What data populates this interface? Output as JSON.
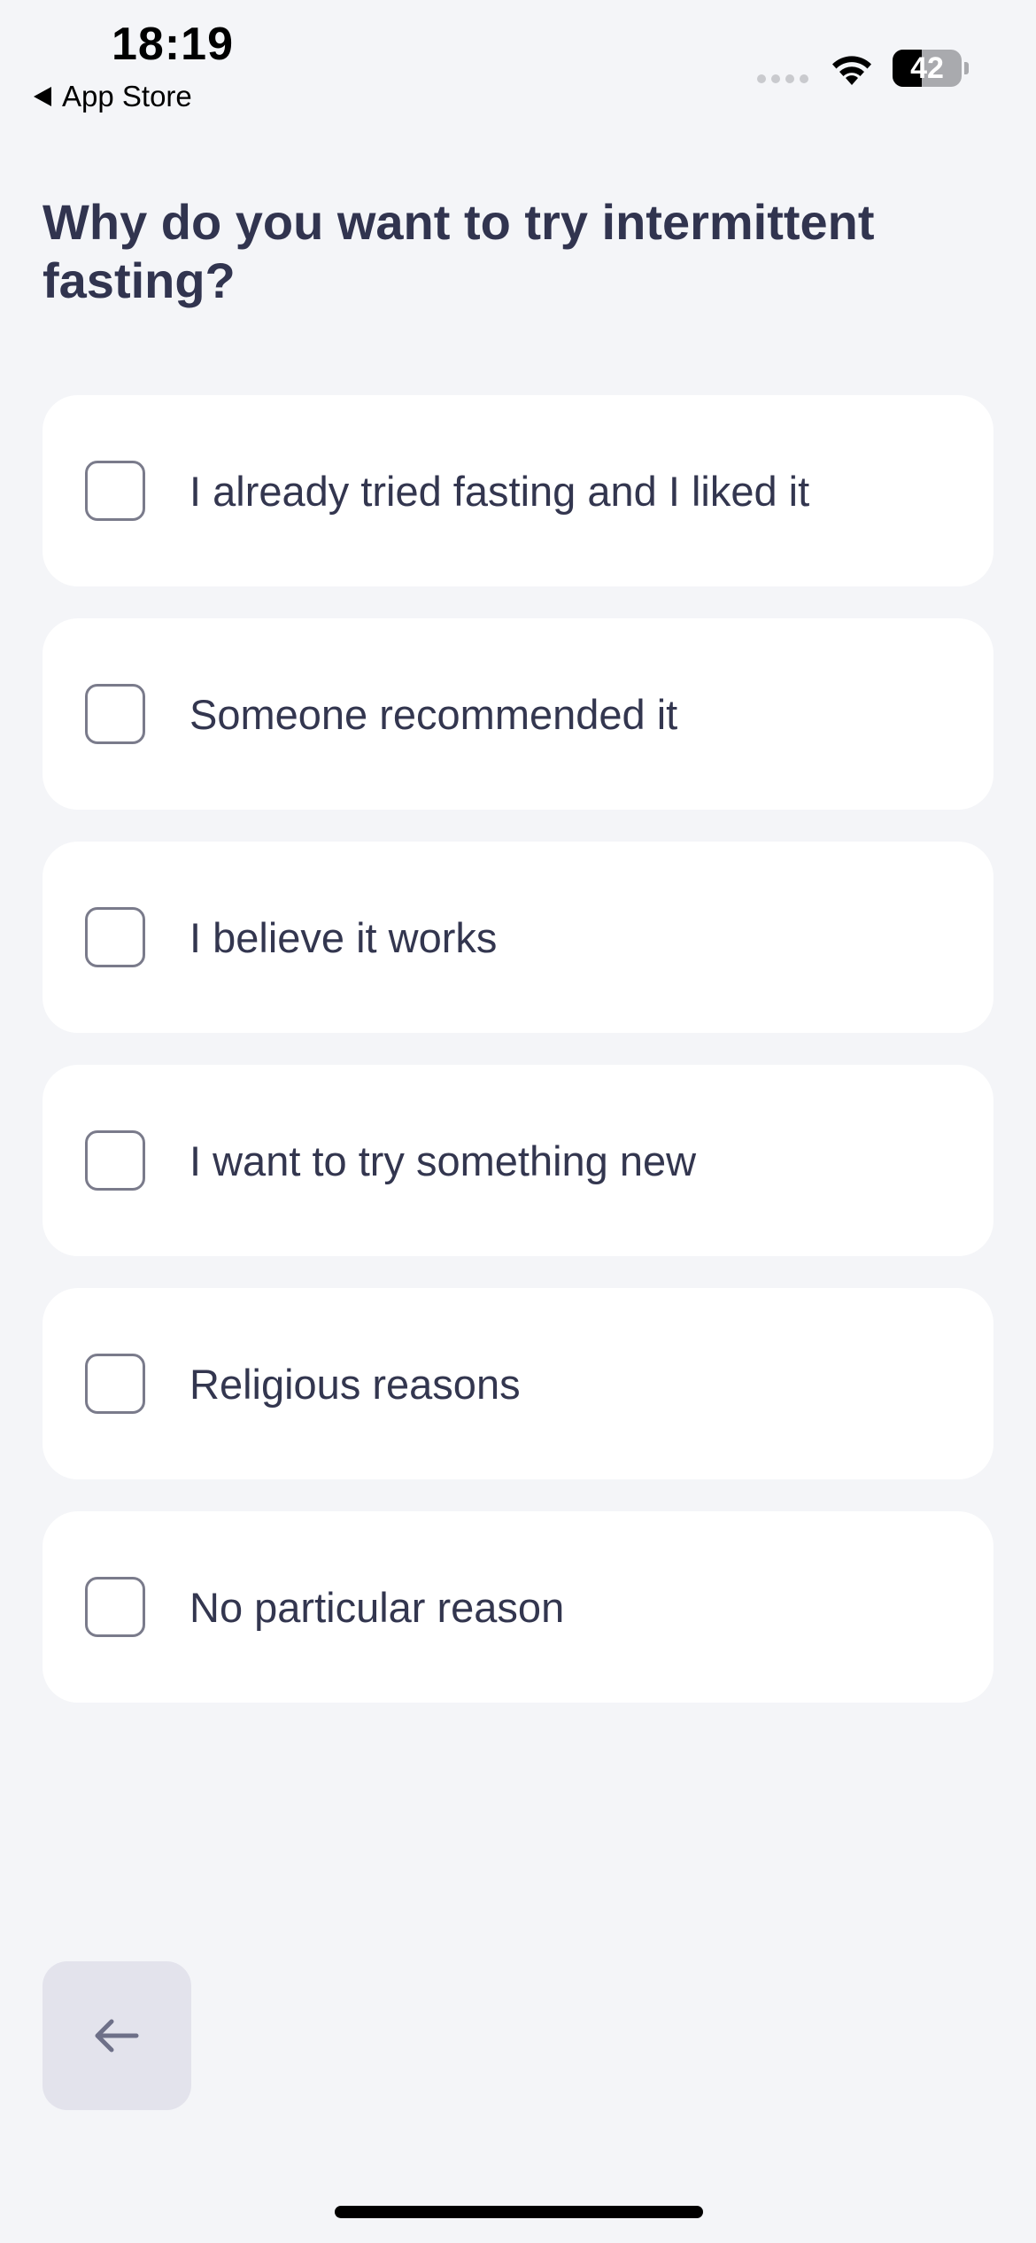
{
  "status_bar": {
    "time": "18:19",
    "back_app_label": "App Store",
    "battery_level": "42",
    "battery_fraction": 0.42
  },
  "question": "Why do you want to try intermittent fasting?",
  "options": [
    {
      "label": "I already tried fasting and I liked it",
      "checked": false
    },
    {
      "label": "Someone recommended it",
      "checked": false
    },
    {
      "label": "I believe it works",
      "checked": false
    },
    {
      "label": "I want to try something new",
      "checked": false
    },
    {
      "label": "Religious reasons",
      "checked": false
    },
    {
      "label": "No particular reason",
      "checked": false
    }
  ],
  "icons": {
    "back": "arrow-left-icon",
    "wifi": "wifi-icon",
    "battery": "battery-icon",
    "signal": "cellular-signal-icon"
  },
  "colors": {
    "background": "#f4f5f8",
    "card": "#ffffff",
    "text": "#33364f",
    "checkbox_border": "#7a7b8b",
    "back_button_bg": "#e3e3ec"
  }
}
